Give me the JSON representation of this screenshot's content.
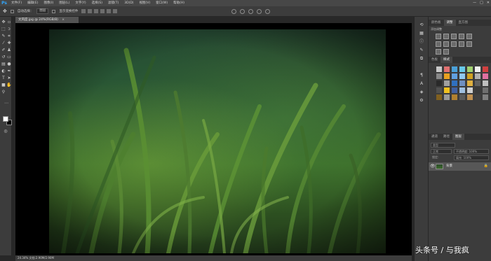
{
  "app": {
    "logo": "Ps"
  },
  "menu": [
    "文件(F)",
    "编辑(E)",
    "图像(I)",
    "图层(L)",
    "文字(Y)",
    "选择(S)",
    "滤镜(T)",
    "3D(D)",
    "视图(V)",
    "窗口(W)",
    "帮助(H)"
  ],
  "window_controls": {
    "minimize": "—",
    "maximize": "□",
    "close": "✕"
  },
  "options": {
    "auto_select_label": "自动选择：",
    "auto_select_value": "图层",
    "show_transform_label": "显示变换控件"
  },
  "document": {
    "tab_title": "文风度.jpg @ 24%(RGB/8)",
    "close": "×"
  },
  "status": {
    "text": "24.34%   文档:2.90M/2.90M"
  },
  "panels": {
    "top_tabs": [
      "颜色板",
      "调整",
      "直方图"
    ],
    "active_top_tab": 1,
    "add_adjustment": "添加调整",
    "mid_tabs": [
      "色板",
      "样式"
    ],
    "active_mid_tab": 1,
    "layer_tabs": [
      "通道",
      "路径",
      "图层"
    ],
    "active_layer_tab": 2,
    "kind_filter": "类型",
    "blend_mode": "正常",
    "opacity_label": "不透明度: 100%",
    "fill_label": "填充: 100%",
    "lock_label": "锁定:"
  },
  "layers": [
    {
      "name": "背景",
      "visible": true,
      "locked": true
    }
  ],
  "swatch_colors": [
    "#c8c8c8",
    "#e07070",
    "#4aa0d8",
    "#68c8e8",
    "#a0d070",
    "#f0f0f0",
    "#d04040",
    "#888888",
    "#e8a020",
    "#60a0e0",
    "#90c8f0",
    "#d0a020",
    "#b0b0b0",
    "#e070a0",
    "#2a2a2a",
    "#a0a0a0",
    "#3070c0",
    "#7090c0",
    "#e0b040",
    "#606060",
    "#c0c0c0",
    "#505050",
    "#f0c020",
    "#4060a0",
    "#a0c0e0",
    "#d0d0d0",
    "#3a3a3a",
    "#707070",
    "#806020",
    "#9a9a9a",
    "#b08030",
    "#5a5a5a",
    "#c09050",
    "#404040",
    "#808080"
  ],
  "watermark": "头条号 / 与我疯"
}
